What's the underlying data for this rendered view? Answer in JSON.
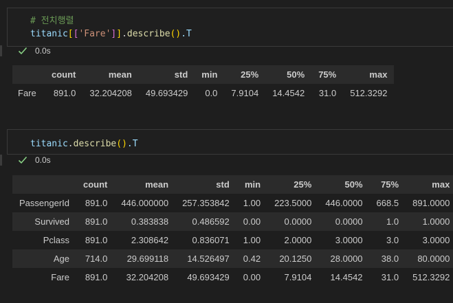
{
  "cell1": {
    "code": {
      "comment": "# 전치행렬",
      "var": "titanic",
      "br_open": "[",
      "br2_open": "[",
      "str": "'Fare'",
      "br2_close": "]",
      "br_close": "]",
      "dot1": ".",
      "fn": "describe",
      "paren": "()",
      "tail": ".T"
    },
    "status_time": "0.0s"
  },
  "output1": {
    "columns": [
      "",
      "count",
      "mean",
      "std",
      "min",
      "25%",
      "50%",
      "75%",
      "max"
    ],
    "rows": [
      [
        "Fare",
        "891.0",
        "32.204208",
        "49.693429",
        "0.0",
        "7.9104",
        "14.4542",
        "31.0",
        "512.3292"
      ]
    ]
  },
  "cell2": {
    "code": {
      "var": "titanic",
      "dot1": ".",
      "fn": "describe",
      "paren": "()",
      "tail": ".T"
    },
    "status_time": "0.0s"
  },
  "output2": {
    "columns": [
      "",
      "count",
      "mean",
      "std",
      "min",
      "25%",
      "50%",
      "75%",
      "max"
    ],
    "rows": [
      [
        "PassengerId",
        "891.0",
        "446.000000",
        "257.353842",
        "1.00",
        "223.5000",
        "446.0000",
        "668.5",
        "891.0000"
      ],
      [
        "Survived",
        "891.0",
        "0.383838",
        "0.486592",
        "0.00",
        "0.0000",
        "0.0000",
        "1.0",
        "1.0000"
      ],
      [
        "Pclass",
        "891.0",
        "2.308642",
        "0.836071",
        "1.00",
        "2.0000",
        "3.0000",
        "3.0",
        "3.0000"
      ],
      [
        "Age",
        "714.0",
        "29.699118",
        "14.526497",
        "0.42",
        "20.1250",
        "28.0000",
        "38.0",
        "80.0000"
      ],
      [
        "Fare",
        "891.0",
        "32.204208",
        "49.693429",
        "0.00",
        "7.9104",
        "14.4542",
        "31.0",
        "512.3292"
      ]
    ]
  },
  "colors": {
    "background": "#1e1e1e",
    "check": "#89d185",
    "comment": "#6a9955",
    "variable": "#9cdcfe",
    "string": "#ce9178",
    "function": "#dcdcaa"
  },
  "icons": {
    "status": "check-icon"
  }
}
